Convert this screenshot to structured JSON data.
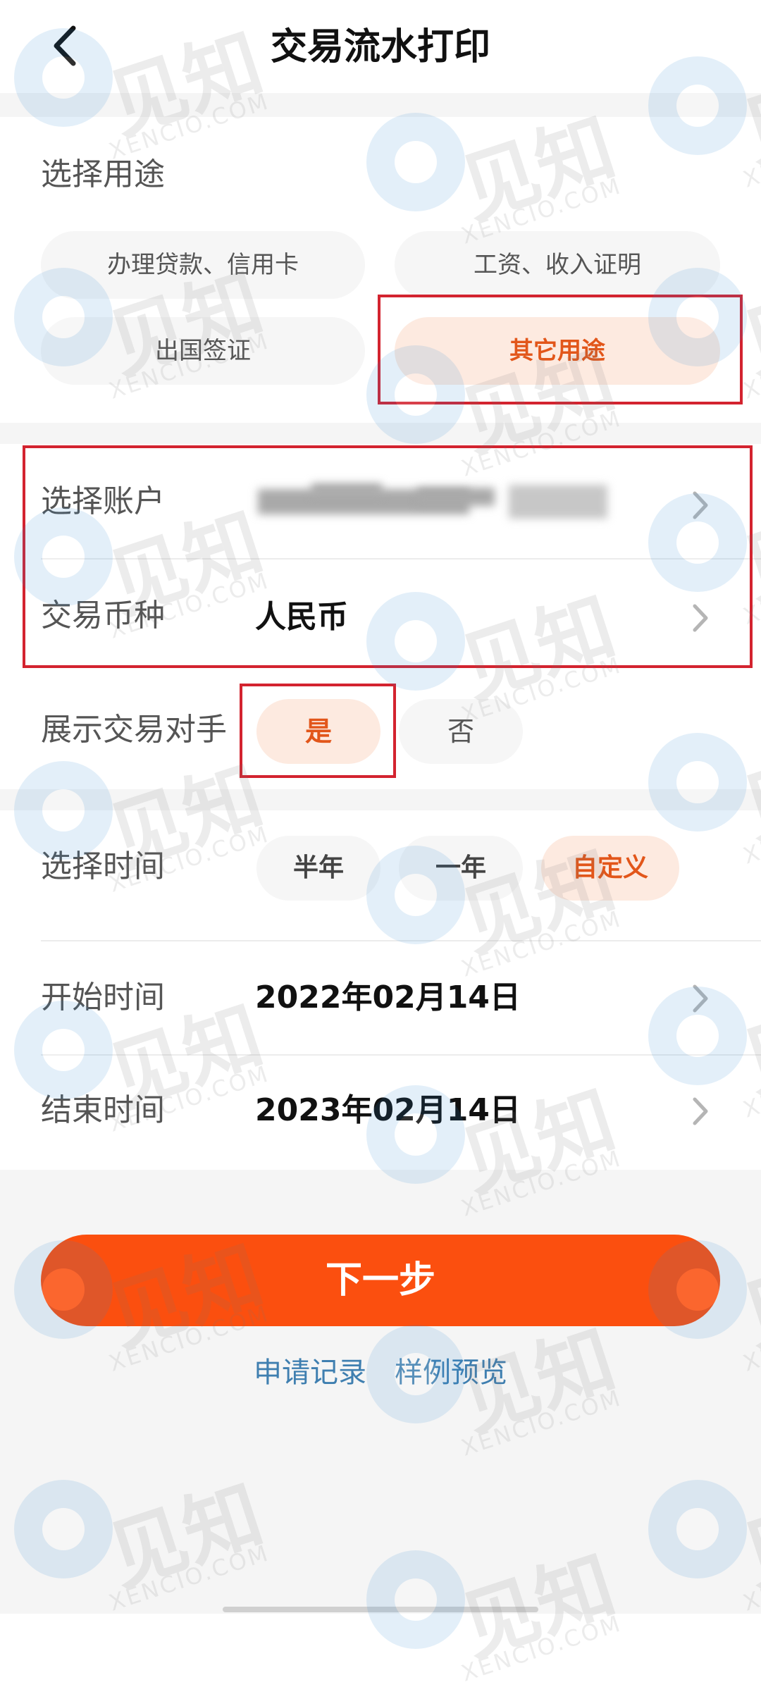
{
  "header": {
    "title": "交易流水打印"
  },
  "purpose": {
    "label": "选择用途",
    "options": [
      {
        "label": "办理贷款、信用卡",
        "selected": false
      },
      {
        "label": "工资、收入证明",
        "selected": false
      },
      {
        "label": "出国签证",
        "selected": false
      },
      {
        "label": "其它用途",
        "selected": true
      }
    ]
  },
  "account": {
    "label": "选择账户"
  },
  "currency": {
    "label": "交易币种",
    "value": "人民币"
  },
  "counterparty": {
    "label": "展示交易对手",
    "options": [
      {
        "label": "是",
        "selected": true
      },
      {
        "label": "否",
        "selected": false
      }
    ]
  },
  "time_range": {
    "label": "选择时间",
    "options": [
      {
        "label": "半年",
        "selected": false
      },
      {
        "label": "一年",
        "selected": false
      },
      {
        "label": "自定义",
        "selected": true
      }
    ]
  },
  "start_time": {
    "label": "开始时间",
    "value": "2022年02月14日"
  },
  "end_time": {
    "label": "结束时间",
    "value": "2023年02月14日"
  },
  "actions": {
    "next_label": "下一步",
    "records_link": "申请记录",
    "sample_link": "样例预览"
  },
  "watermark": {
    "brand": "见知",
    "domain": "XENCIO.COM"
  },
  "colors": {
    "accent": "#fb4f0f",
    "selected_text": "#e2561a",
    "selected_bg": "#fdeae0",
    "annotation_box": "#d3232f",
    "link": "#3f7fb0"
  }
}
